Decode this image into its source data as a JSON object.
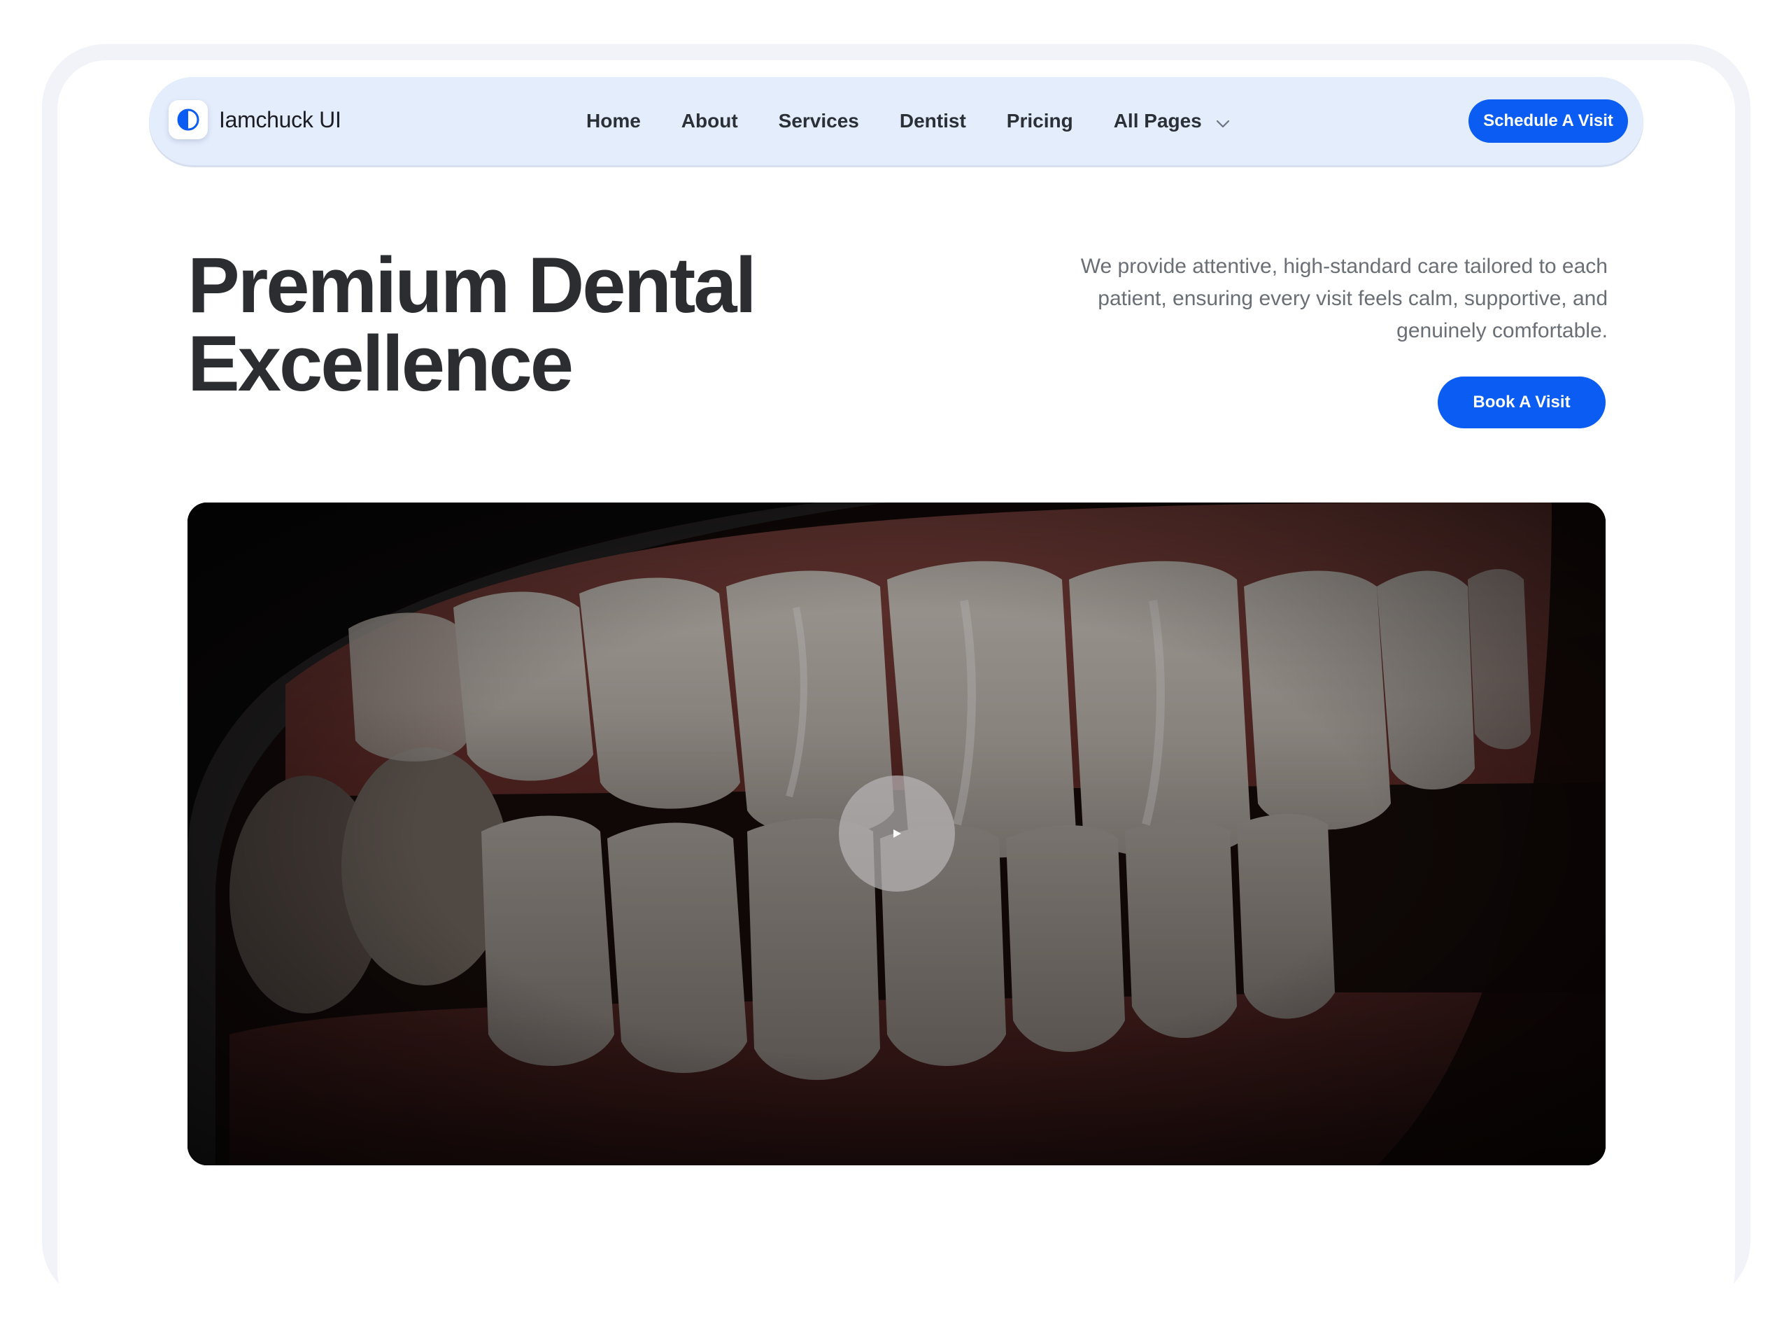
{
  "nav": {
    "brand": "Iamchuck UI",
    "links": [
      {
        "label": "Home"
      },
      {
        "label": "About"
      },
      {
        "label": "Services"
      },
      {
        "label": "Dentist"
      },
      {
        "label": "Pricing"
      },
      {
        "label": "All Pages"
      }
    ],
    "cta_label": "Schedule A Visit"
  },
  "hero": {
    "title_line1": "Premium Dental",
    "title_line2": "Excellence",
    "description": "We provide attentive, high-standard care tailored to each patient, ensuring every visit feels calm, supportive, and genuinely comfortable.",
    "cta_label": "Book A Visit"
  },
  "media": {
    "type": "video",
    "play_icon": "play-icon"
  },
  "colors": {
    "accent": "#0a5cf3",
    "nav_bg": "#e4edfc",
    "title": "#2c2d31",
    "body_text": "#6a6e75"
  }
}
